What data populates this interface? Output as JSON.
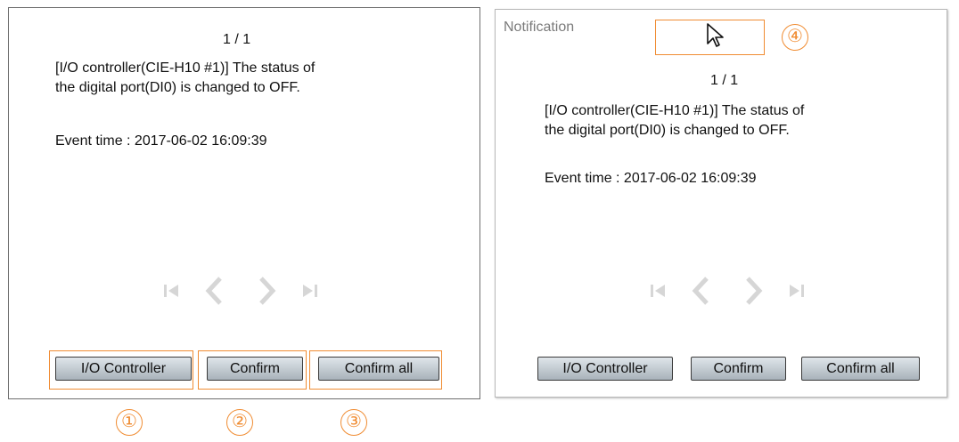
{
  "left_dialog": {
    "counter": "1 / 1",
    "message_line1": "[I/O controller(CIE-H10 #1)] The status of",
    "message_line2": "the digital port(DI0) is changed to OFF.",
    "event_time": "Event time : 2017-06-02 16:09:39",
    "buttons": {
      "io_controller": "I/O Controller",
      "confirm": "Confirm",
      "confirm_all": "Confirm all"
    }
  },
  "right_dialog": {
    "title": "Notification",
    "counter": "1 / 1",
    "message_line1": "[I/O controller(CIE-H10 #1)] The status of",
    "message_line2": "the digital port(DI0) is changed to OFF.",
    "event_time": "Event time : 2017-06-02 16:09:39",
    "buttons": {
      "io_controller": "I/O Controller",
      "confirm": "Confirm",
      "confirm_all": "Confirm all"
    }
  },
  "callouts": {
    "one": "①",
    "two": "②",
    "three": "③",
    "four": "④"
  },
  "colors": {
    "callout": "#f08c32",
    "nav_icon": "#d6d6d6",
    "button_top": "#dfe5ea",
    "button_bottom": "#a8b2ba"
  },
  "icons": [
    "first-page-icon",
    "previous-icon",
    "next-icon",
    "last-page-icon",
    "mouse-cursor-icon"
  ]
}
